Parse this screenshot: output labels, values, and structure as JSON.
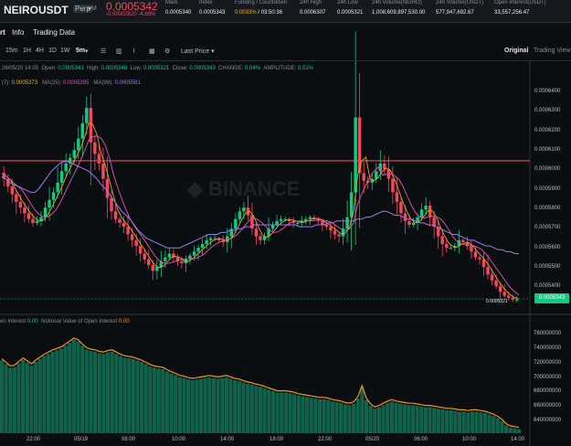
{
  "header": {
    "symbol": "NEIROUSDT",
    "contract_type": "Perp",
    "margin_mode": "M",
    "last_price": "0.0005342",
    "price_change": "-0.00002620",
    "price_change_pct": "-4.68%",
    "stats": [
      {
        "label": "Mark",
        "value": "0.0005340"
      },
      {
        "label": "Index",
        "value": "0.0005343"
      },
      {
        "label": "Funding / Countdown",
        "value": "0.0033%",
        "value2": "03:50:36"
      },
      {
        "label": "24h High",
        "value": "0.0006307"
      },
      {
        "label": "24h Low",
        "value": "0.0005321"
      },
      {
        "label": "24h Volume(NEIRO)",
        "value": "1,008,609,897,530.00"
      },
      {
        "label": "24h Volume(USDT)",
        "value": "577,947,692.67"
      },
      {
        "label": "Open Interest(USDT)",
        "value": "33,557,256.47"
      }
    ]
  },
  "tabs": {
    "chart": "rt",
    "info": "Info",
    "trading_data": "Trading Data"
  },
  "toolbar": {
    "intervals": [
      "15m",
      "1H",
      "4H",
      "1D",
      "1W",
      "5m"
    ],
    "active_interval": "5m",
    "price_type": "Last Price",
    "view_original": "Original",
    "view_tradingview": "Trading View"
  },
  "ohlc": {
    "time": "26/05/20 14:05",
    "open_label": "Open:",
    "open": "0.0005341",
    "high_label": "High:",
    "high": "0.0005348",
    "low_label": "Low:",
    "low": "0.0005321",
    "close_label": "Close:",
    "close": "0.0005343",
    "change_label": "CHANGE:",
    "change": "0.04%",
    "amplitude_label": "AMPLITUDE:",
    "amplitude": "0.51%"
  },
  "ma": {
    "ma7_label": "(7):",
    "ma7": "0.0005373",
    "ma25_label": "MA(25):",
    "ma25": "0.0005395",
    "ma99_label": "MA(99):",
    "ma99": "0.0005581"
  },
  "open_interest": {
    "title": "en Interest",
    "value": "0.00",
    "notional_label": "Notional Value of Open Interest",
    "notional_value": "0.00"
  },
  "chart_data": {
    "type": "candlestick",
    "price_axis": [
      "0.0006400",
      "0.0006300",
      "0.0006200",
      "0.0006100",
      "0.0006000",
      "0.0005900",
      "0.0005800",
      "0.0005700",
      "0.0005600",
      "0.0005500",
      "0.0005400"
    ],
    "current_price_tag": "0.0005343",
    "low_marker": "0.0005321",
    "time_axis": [
      "22:00",
      "05/19",
      "06:00",
      "10:00",
      "14:00",
      "18:00",
      "22:00",
      "05/20",
      "06:00",
      "10:00",
      "14:00"
    ],
    "ylim": [
      0.000532,
      0.000645
    ],
    "price_series": [
      0.0006,
      0.000597,
      0.000593,
      0.000589,
      0.000585,
      0.000582,
      0.000579,
      0.000576,
      0.000574,
      0.000575,
      0.000577,
      0.000582,
      0.000586,
      0.00059,
      0.000595,
      0.000601,
      0.000605,
      0.000608,
      0.000612,
      0.000618,
      0.000626,
      0.000634,
      0.000616,
      0.00061,
      0.000605,
      0.000597,
      0.000587,
      0.00058,
      0.000576,
      0.000574,
      0.000572,
      0.000568,
      0.000565,
      0.000562,
      0.000558,
      0.000555,
      0.000552,
      0.000549,
      0.000551,
      0.000554,
      0.000556,
      0.000558,
      0.000556,
      0.000554,
      0.000553,
      0.000555,
      0.000557,
      0.000559,
      0.000561,
      0.000563,
      0.000565,
      0.000566,
      0.000566,
      0.000565,
      0.000564,
      0.000567,
      0.000571,
      0.000576,
      0.00058,
      0.000582,
      0.000578,
      0.000571,
      0.000567,
      0.000565,
      0.000567,
      0.000571,
      0.000573,
      0.000575,
      0.000576,
      0.000576,
      0.000575,
      0.000574,
      0.000574,
      0.000575,
      0.000576,
      0.000577,
      0.000576,
      0.000575,
      0.000573,
      0.000572,
      0.00057,
      0.000568,
      0.000567,
      0.000571,
      0.000577,
      0.00059,
      0.000629,
      0.0006,
      0.000596,
      0.000595,
      0.000597,
      0.000601,
      0.000605,
      0.000602,
      0.000597,
      0.00059,
      0.000585,
      0.000579,
      0.000575,
      0.000573,
      0.000574,
      0.000577,
      0.000581,
      0.000583,
      0.000577,
      0.000572,
      0.000567,
      0.000563,
      0.000561,
      0.000561,
      0.000562,
      0.000565,
      0.000564,
      0.000562,
      0.000559,
      0.000556,
      0.000555,
      0.000551,
      0.000547,
      0.000544,
      0.000541,
      0.000538,
      0.000536,
      0.000535,
      0.000534,
      0.000534
    ],
    "ma99_price": [
      0.000598,
      0.000597,
      0.000595,
      0.000594,
      0.000593,
      0.000592,
      0.000591,
      0.00059,
      0.00059,
      0.000592,
      0.000595,
      0.000598,
      0.000601,
      0.000603,
      0.000605,
      0.000606,
      0.000606,
      0.000605,
      0.000604,
      0.000603,
      0.000602,
      0.000601,
      0.000599,
      0.000597,
      0.000594,
      0.000592,
      0.000589,
      0.000586,
      0.000583,
      0.00058,
      0.000578,
      0.000576,
      0.000573,
      0.00057,
      0.000568,
      0.000566,
      0.000565,
      0.000564,
      0.000563,
      0.000562,
      0.000561,
      0.000561,
      0.000561,
      0.000561,
      0.000562,
      0.000563,
      0.000564,
      0.000565,
      0.000566,
      0.000567,
      0.000568,
      0.000568,
      0.000568,
      0.000569,
      0.000569,
      0.00057,
      0.00057,
      0.000571,
      0.000571,
      0.000572,
      0.000572,
      0.000573,
      0.000573,
      0.000573,
      0.000573,
      0.000573,
      0.000573,
      0.000573,
      0.000573,
      0.000573,
      0.000573,
      0.000573,
      0.000572,
      0.000572,
      0.000572,
      0.000572,
      0.000573,
      0.000573,
      0.000573,
      0.000574,
      0.000574,
      0.000575,
      0.000575,
      0.000575,
      0.000575,
      0.000575,
      0.000576,
      0.000576,
      0.000577,
      0.000577,
      0.000578,
      0.000579,
      0.00058,
      0.00058,
      0.000579,
      0.000578,
      0.000578,
      0.000577,
      0.000576,
      0.000576,
      0.000575,
      0.000574,
      0.000574,
      0.000573,
      0.000573,
      0.000572,
      0.000571,
      0.00057,
      0.000569,
      0.000568,
      0.000568,
      0.000567,
      0.000566,
      0.000565,
      0.000565,
      0.000564,
      0.000563,
      0.000562,
      0.000562,
      0.000561,
      0.00056,
      0.00056,
      0.000559,
      0.000559,
      0.000558,
      0.000558
    ],
    "horizontal_line_price": 0.0006064,
    "oi_axis": [
      "760000000",
      "740000000",
      "720000000",
      "700000000",
      "680000000",
      "660000000",
      "640000000"
    ],
    "oi_ylim": [
      630000000,
      770000000
    ],
    "oi_series": [
      732000000,
      727000000,
      722000000,
      723000000,
      728000000,
      733000000,
      729000000,
      725000000,
      730000000,
      734000000,
      738000000,
      741000000,
      744000000,
      746000000,
      748000000,
      752000000,
      756000000,
      760000000,
      758000000,
      752000000,
      747000000,
      745000000,
      744000000,
      742000000,
      741000000,
      743000000,
      744000000,
      741000000,
      738000000,
      736000000,
      735000000,
      734000000,
      732000000,
      730000000,
      727000000,
      724000000,
      722000000,
      721000000,
      720000000,
      717000000,
      714000000,
      712000000,
      709000000,
      708000000,
      706000000,
      705000000,
      706000000,
      707000000,
      708000000,
      709000000,
      708000000,
      707000000,
      708000000,
      709000000,
      707000000,
      705000000,
      704000000,
      702000000,
      700000000,
      699000000,
      697000000,
      696000000,
      694000000,
      692000000,
      690000000,
      688000000,
      688000000,
      688000000,
      687000000,
      686000000,
      684000000,
      683000000,
      682000000,
      681000000,
      680000000,
      679000000,
      679000000,
      678000000,
      676000000,
      675000000,
      674000000,
      672000000,
      671000000,
      673000000,
      680000000,
      695000000,
      678000000,
      670000000,
      666000000,
      668000000,
      671000000,
      674000000,
      676000000,
      674000000,
      673000000,
      672000000,
      671000000,
      671000000,
      670000000,
      669000000,
      668000000,
      668000000,
      667000000,
      666000000,
      665000000,
      664000000,
      664000000,
      663000000,
      662000000,
      662000000,
      661000000,
      662000000,
      662000000,
      661000000,
      660000000,
      658000000,
      656000000,
      653000000,
      649000000,
      643000000,
      640000000,
      639000000,
      638000000
    ]
  }
}
